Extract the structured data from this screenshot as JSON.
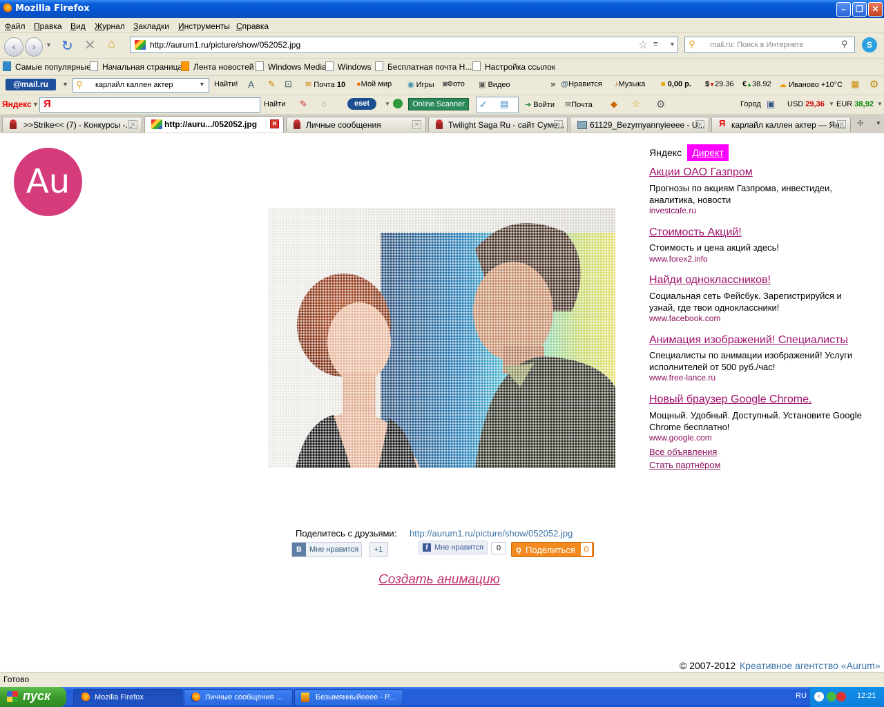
{
  "window": {
    "title": "Mozilla Firefox"
  },
  "menu": {
    "items": [
      "Файл",
      "Правка",
      "Вид",
      "Журнал",
      "Закладки",
      "Инструменты",
      "Справка"
    ]
  },
  "nav": {
    "url": "http://aurum1.ru/picture/show/052052.jpg",
    "search_placeholder": "mail.ru: Поиск в Интернете"
  },
  "bookmarks": [
    "Самые популярные",
    "Начальная страница",
    "Лента новостей",
    "Windows Media",
    "Windows",
    "Бесплатная почта Н...",
    "Настройка ссылок"
  ],
  "mailbar": {
    "logo": "@mail.ru",
    "query": "карлайл каллен актер",
    "find": "Найти!",
    "mail_label": "Почта",
    "mail_count": "10",
    "mymir": "Мой мир",
    "games": "Игры",
    "photo": "Фото",
    "video": "Видео",
    "like": "Нравится",
    "music": "Музыка",
    "money": "0,00 р.",
    "usd": "29.36",
    "eur": "38.92",
    "weather": "Иваново +10°C"
  },
  "yandexbar": {
    "logo": "Яндекс",
    "find": "Найти",
    "eset": "eset",
    "scanner": "Online Scanner",
    "login": "Войти",
    "mail": "Почта",
    "city": "Город",
    "usd_label": "USD",
    "usd": "29,36",
    "eur_label": "EUR",
    "eur": "38,92"
  },
  "tabs": [
    {
      "label": ">>Strike<< (7) - Конкурсы -..."
    },
    {
      "label": "http://auru.../052052.jpg"
    },
    {
      "label": "Личные сообщения"
    },
    {
      "label": "Twilight Saga Ru - сайт Суме..."
    },
    {
      "label": "61129_Bezymyannyieeee - U..."
    },
    {
      "label": "карлайл каллен актер — Ян..."
    }
  ],
  "page": {
    "logo": "Au",
    "share_label": "Поделитесь с друзьями:",
    "share_url": "http://aurum1.ru/picture/show/052052.jpg",
    "vk_letter": "В",
    "vk_like": "Мне нравится",
    "plus_one": "+1",
    "fb_like": "Мне нравится",
    "fb_count": "0",
    "ok_share": "Поделиться",
    "ok_count": "0",
    "create_animation": "Создать анимацию",
    "copyright": "© 2007-2012",
    "agency": "Креативное агентство «Aurum»"
  },
  "ads": {
    "yandex": "Яндекс",
    "direct": "Директ",
    "items": [
      {
        "title": "Акции ОАО Газпром",
        "body": "Прогнозы по акциям Газпрома, инвестидеи, аналитика, новости",
        "url": "investcafe.ru"
      },
      {
        "title": "Стоимость Акций!",
        "body": "Стоимость и цена акций здесь!",
        "url": "www.forex2.info"
      },
      {
        "title": "Найди одноклассников!",
        "body": "Социальная сеть Фейсбук. Зарегистрируйся и узнай, где твои одноклассники!",
        "url": "www.facebook.com"
      },
      {
        "title": "Анимация изображений! Специалисты",
        "body": "Специалисты по анимации изображений! Услуги исполнителей от 500 руб./час!",
        "url": "www.free-lance.ru"
      },
      {
        "title": "Новый браузер Google Chrome.",
        "body": "Мощный. Удобный. Доступный. Установите Google Chrome бесплатно!",
        "url": "www.google.com"
      }
    ],
    "all_ads": "Все объявления",
    "partner": "Стать партнёром"
  },
  "status": {
    "text": "Готово"
  },
  "taskbar": {
    "start": "пуск",
    "tasks": [
      "Mozilla Firefox",
      "Личные сообщения ...",
      "Безымянныйeeee - P..."
    ],
    "lang": "RU",
    "time": "12:21"
  },
  "colors": {
    "accent": "#d63b7b",
    "ad_link": "#a1126d",
    "share_link": "#3b74a6",
    "direct_bg": "#ff00ff"
  }
}
